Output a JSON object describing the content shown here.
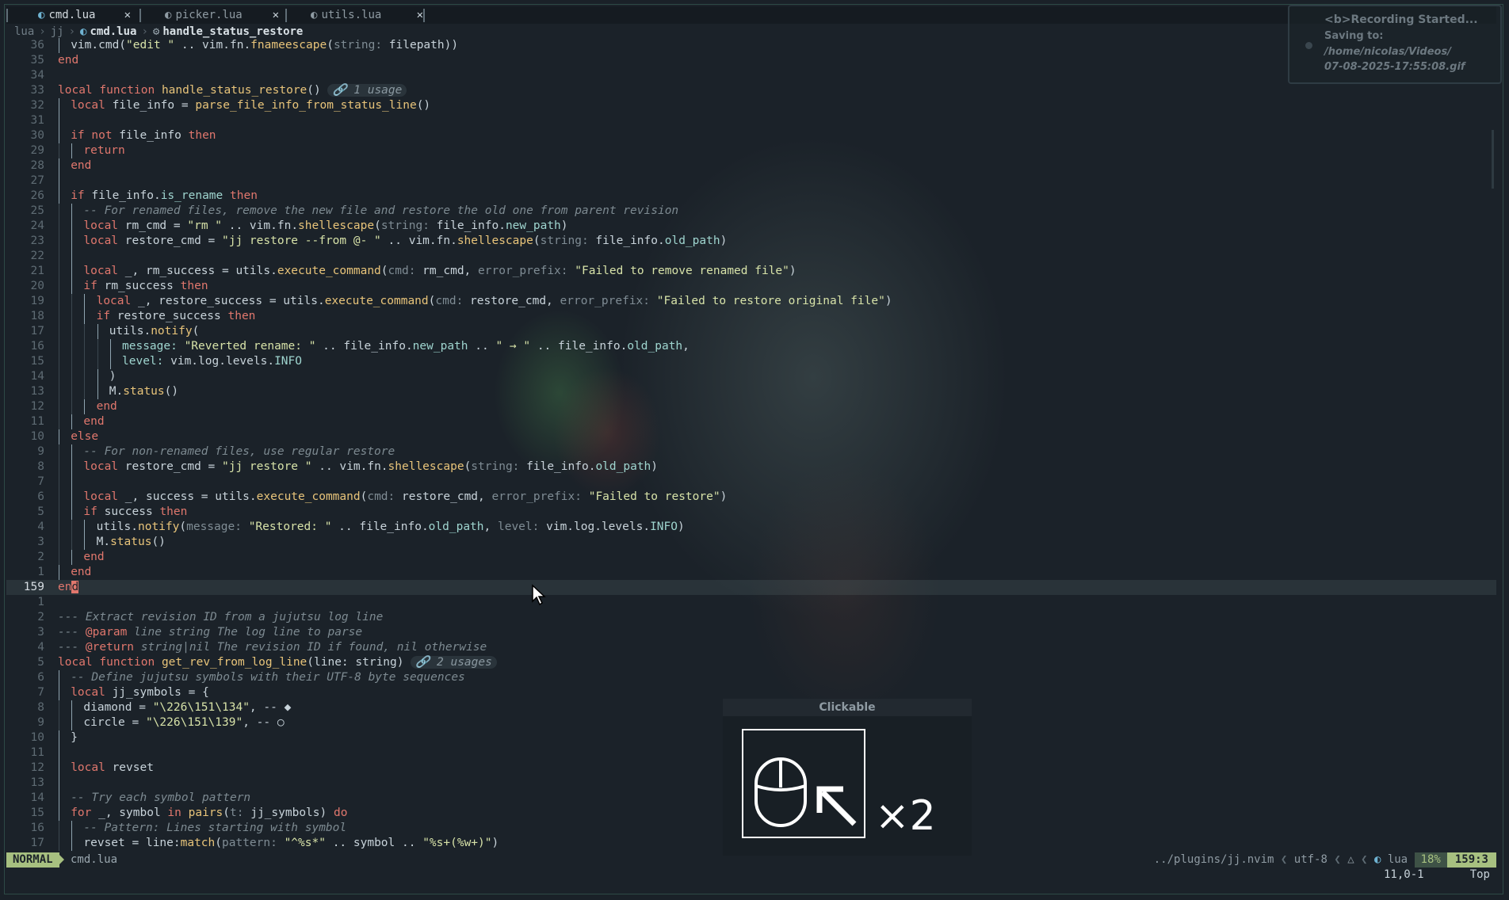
{
  "tabs": [
    {
      "label": "cmd.lua",
      "icon": "lua-file-icon",
      "active": true
    },
    {
      "label": "picker.lua",
      "icon": "lua-file-icon",
      "active": false
    },
    {
      "label": "utils.lua",
      "icon": "lua-file-icon",
      "active": false
    }
  ],
  "tab_close_glyph": "✕",
  "breadcrumb": {
    "part1": "lua",
    "part2": "jj",
    "file": "cmd.lua",
    "function": "handle_status_restore",
    "sep": "›"
  },
  "notification": {
    "title": "<b>Recording Started...",
    "line1": "Saving to:",
    "line2": "/home/nicolas/Videos/",
    "line3": "07-08-2025-17:55:08.gif"
  },
  "overlay": {
    "title": "Clickable",
    "count": "×2"
  },
  "statusline": {
    "mode": "NORMAL",
    "file": "cmd.lua",
    "path": "../plugins/jj.nvim",
    "encoding": "utf-8",
    "filetype": "lua",
    "percent": "18%",
    "position": "159:3"
  },
  "cmdline": {
    "ruler": "11,0-1",
    "scroll": "Top"
  },
  "colors": {
    "accent": "#a7c080",
    "keyword": "#e0776d",
    "string": "#d7e2a8",
    "function": "#e8c47a"
  },
  "lines": [
    {
      "n": "36",
      "d": 1,
      "c": [
        [
          "vim.cmd(",
          ""
        ],
        [
          "\"edit \"",
          "str"
        ],
        [
          " .. vim.fn.",
          ""
        ],
        [
          "fnameescape",
          "fnc"
        ],
        [
          "(",
          ""
        ],
        [
          "string:",
          "hint"
        ],
        [
          " filepath))",
          ""
        ]
      ]
    },
    {
      "n": "35",
      "d": 0,
      "c": [
        [
          "end",
          "kw"
        ]
      ]
    },
    {
      "n": "34",
      "d": 0,
      "c": []
    },
    {
      "n": "33",
      "d": 0,
      "c": [
        [
          "local function ",
          "kw"
        ],
        [
          "handle_status_restore",
          "fnc"
        ],
        [
          "() ",
          ""
        ]
      ],
      "usage": "🔗 1 usage"
    },
    {
      "n": "32",
      "d": 1,
      "c": [
        [
          "local ",
          "kw"
        ],
        [
          "file_info = ",
          ""
        ],
        [
          "parse_file_info_from_status_line",
          "fnc"
        ],
        [
          "()",
          ""
        ]
      ]
    },
    {
      "n": "31",
      "d": 1,
      "c": []
    },
    {
      "n": "30",
      "d": 1,
      "c": [
        [
          "if not ",
          "kw"
        ],
        [
          "file_info ",
          ""
        ],
        [
          "then",
          "kw"
        ]
      ]
    },
    {
      "n": "29",
      "d": 2,
      "c": [
        [
          "return",
          "kw"
        ]
      ]
    },
    {
      "n": "28",
      "d": 1,
      "c": [
        [
          "end",
          "kw"
        ]
      ]
    },
    {
      "n": "27",
      "d": 1,
      "c": []
    },
    {
      "n": "26",
      "d": 1,
      "c": [
        [
          "if ",
          "kw"
        ],
        [
          "file_info.",
          ""
        ],
        [
          "is_rename",
          "fld"
        ],
        [
          " ",
          ""
        ],
        [
          "then",
          "kw"
        ]
      ]
    },
    {
      "n": "25",
      "d": 2,
      "c": [
        [
          "-- For renamed files, remove the new file and restore the old one from parent revision",
          "cm"
        ]
      ]
    },
    {
      "n": "24",
      "d": 2,
      "c": [
        [
          "local ",
          "kw"
        ],
        [
          "rm_cmd = ",
          ""
        ],
        [
          "\"rm \"",
          "str"
        ],
        [
          " .. vim.fn.",
          ""
        ],
        [
          "shellescape",
          "fnc"
        ],
        [
          "(",
          ""
        ],
        [
          "string:",
          "hint"
        ],
        [
          " file_info.",
          ""
        ],
        [
          "new_path",
          "fld"
        ],
        [
          ")",
          ""
        ]
      ]
    },
    {
      "n": "23",
      "d": 2,
      "c": [
        [
          "local ",
          "kw"
        ],
        [
          "restore_cmd = ",
          ""
        ],
        [
          "\"jj restore --from @- \"",
          "str"
        ],
        [
          " .. vim.fn.",
          ""
        ],
        [
          "shellescape",
          "fnc"
        ],
        [
          "(",
          ""
        ],
        [
          "string:",
          "hint"
        ],
        [
          " file_info.",
          ""
        ],
        [
          "old_path",
          "fld"
        ],
        [
          ")",
          ""
        ]
      ]
    },
    {
      "n": "22",
      "d": 2,
      "c": []
    },
    {
      "n": "21",
      "d": 2,
      "c": [
        [
          "local ",
          "kw"
        ],
        [
          "_, rm_success = utils.",
          ""
        ],
        [
          "execute_command",
          "fnc"
        ],
        [
          "(",
          ""
        ],
        [
          "cmd:",
          "hint"
        ],
        [
          " rm_cmd, ",
          ""
        ],
        [
          "error_prefix:",
          "hint"
        ],
        [
          " ",
          ""
        ],
        [
          "\"Failed to remove renamed file\"",
          "str"
        ],
        [
          ")",
          ""
        ]
      ]
    },
    {
      "n": "20",
      "d": 2,
      "c": [
        [
          "if ",
          "kw"
        ],
        [
          "rm_success ",
          ""
        ],
        [
          "then",
          "kw"
        ]
      ]
    },
    {
      "n": "19",
      "d": 3,
      "c": [
        [
          "local ",
          "kw"
        ],
        [
          "_, restore_success = utils.",
          ""
        ],
        [
          "execute_command",
          "fnc"
        ],
        [
          "(",
          ""
        ],
        [
          "cmd:",
          "hint"
        ],
        [
          " restore_cmd, ",
          ""
        ],
        [
          "error_prefix:",
          "hint"
        ],
        [
          " ",
          ""
        ],
        [
          "\"Failed to restore original file\"",
          "str"
        ],
        [
          ")",
          ""
        ]
      ]
    },
    {
      "n": "18",
      "d": 3,
      "c": [
        [
          "if ",
          "kw"
        ],
        [
          "restore_success ",
          ""
        ],
        [
          "then",
          "kw"
        ]
      ]
    },
    {
      "n": "17",
      "d": 4,
      "c": [
        [
          "utils.",
          ""
        ],
        [
          "notify",
          "fnc"
        ],
        [
          "(",
          ""
        ]
      ]
    },
    {
      "n": "16",
      "d": 5,
      "c": [
        [
          "message:",
          "fld"
        ],
        [
          " ",
          ""
        ],
        [
          "\"Reverted rename: \"",
          "str"
        ],
        [
          " .. file_info.",
          ""
        ],
        [
          "new_path",
          "fld"
        ],
        [
          " .. ",
          ""
        ],
        [
          "\" → \"",
          "str"
        ],
        [
          " .. file_info.",
          ""
        ],
        [
          "old_path",
          "fld"
        ],
        [
          ",",
          ""
        ]
      ]
    },
    {
      "n": "15",
      "d": 5,
      "c": [
        [
          "level:",
          "fld"
        ],
        [
          " vim.log.levels.",
          ""
        ],
        [
          "INFO",
          "fld"
        ]
      ]
    },
    {
      "n": "14",
      "d": 4,
      "c": [
        [
          ")",
          ""
        ]
      ]
    },
    {
      "n": "13",
      "d": 4,
      "c": [
        [
          "M.",
          ""
        ],
        [
          "status",
          "fnc"
        ],
        [
          "()",
          ""
        ]
      ]
    },
    {
      "n": "12",
      "d": 3,
      "c": [
        [
          "end",
          "kw"
        ]
      ]
    },
    {
      "n": "11",
      "d": 2,
      "c": [
        [
          "end",
          "kw"
        ]
      ]
    },
    {
      "n": "10",
      "d": 1,
      "c": [
        [
          "else",
          "kw"
        ]
      ]
    },
    {
      "n": "9",
      "d": 2,
      "c": [
        [
          "-- For non-renamed files, use regular restore",
          "cm"
        ]
      ]
    },
    {
      "n": "8",
      "d": 2,
      "c": [
        [
          "local ",
          "kw"
        ],
        [
          "restore_cmd = ",
          ""
        ],
        [
          "\"jj restore \"",
          "str"
        ],
        [
          " .. vim.fn.",
          ""
        ],
        [
          "shellescape",
          "fnc"
        ],
        [
          "(",
          ""
        ],
        [
          "string:",
          "hint"
        ],
        [
          " file_info.",
          ""
        ],
        [
          "old_path",
          "fld"
        ],
        [
          ")",
          ""
        ]
      ]
    },
    {
      "n": "7",
      "d": 2,
      "c": []
    },
    {
      "n": "6",
      "d": 2,
      "c": [
        [
          "local ",
          "kw"
        ],
        [
          "_, success = utils.",
          ""
        ],
        [
          "execute_command",
          "fnc"
        ],
        [
          "(",
          ""
        ],
        [
          "cmd:",
          "hint"
        ],
        [
          " restore_cmd, ",
          ""
        ],
        [
          "error_prefix:",
          "hint"
        ],
        [
          " ",
          ""
        ],
        [
          "\"Failed to restore\"",
          "str"
        ],
        [
          ")",
          ""
        ]
      ]
    },
    {
      "n": "5",
      "d": 2,
      "c": [
        [
          "if ",
          "kw"
        ],
        [
          "success ",
          ""
        ],
        [
          "then",
          "kw"
        ]
      ]
    },
    {
      "n": "4",
      "d": 3,
      "c": [
        [
          "utils.",
          ""
        ],
        [
          "notify",
          "fnc"
        ],
        [
          "(",
          ""
        ],
        [
          "message:",
          "hint"
        ],
        [
          " ",
          ""
        ],
        [
          "\"Restored: \"",
          "str"
        ],
        [
          " .. file_info.",
          ""
        ],
        [
          "old_path",
          "fld"
        ],
        [
          ", ",
          ""
        ],
        [
          "level:",
          "hint"
        ],
        [
          " vim.log.levels.",
          ""
        ],
        [
          "INFO",
          "fld"
        ],
        [
          ")",
          ""
        ]
      ]
    },
    {
      "n": "3",
      "d": 3,
      "c": [
        [
          "M.",
          ""
        ],
        [
          "status",
          "fnc"
        ],
        [
          "()",
          ""
        ]
      ]
    },
    {
      "n": "2",
      "d": 2,
      "c": [
        [
          "end",
          "kw"
        ]
      ]
    },
    {
      "n": "1",
      "d": 1,
      "c": [
        [
          "end",
          "kw"
        ]
      ]
    },
    {
      "n": "159",
      "d": 0,
      "cur": true,
      "c": [
        [
          "en",
          "kw"
        ],
        [
          "d",
          "cursor"
        ]
      ]
    },
    {
      "n": "1",
      "d": 0,
      "c": []
    },
    {
      "n": "2",
      "d": 0,
      "c": [
        [
          "--- Extract revision ID from a jujutsu log line",
          "cm"
        ]
      ]
    },
    {
      "n": "3",
      "d": 0,
      "c": [
        [
          "--- ",
          "cm"
        ],
        [
          "@param",
          "kw"
        ],
        [
          " line string ",
          "cm"
        ],
        [
          "The log line to parse",
          "cm"
        ]
      ]
    },
    {
      "n": "4",
      "d": 0,
      "c": [
        [
          "--- ",
          "cm"
        ],
        [
          "@return",
          "kw"
        ],
        [
          " string|nil ",
          "cm"
        ],
        [
          "The revision ID if found, nil otherwise",
          "cm"
        ]
      ]
    },
    {
      "n": "5",
      "d": 0,
      "c": [
        [
          "local function ",
          "kw"
        ],
        [
          "get_rev_from_log_line",
          "fnc"
        ],
        [
          "(line: string) ",
          ""
        ]
      ],
      "usage": "🔗 2 usages"
    },
    {
      "n": "6",
      "d": 1,
      "c": [
        [
          "-- Define jujutsu symbols with their UTF-8 byte sequences",
          "cm"
        ]
      ]
    },
    {
      "n": "7",
      "d": 1,
      "c": [
        [
          "local ",
          "kw"
        ],
        [
          "jj_symbols = {",
          ""
        ]
      ]
    },
    {
      "n": "8",
      "d": 2,
      "c": [
        [
          "diamond = ",
          ""
        ],
        [
          "\"\\226\\151\\134\"",
          "str"
        ],
        [
          ", -- ◆",
          ""
        ]
      ]
    },
    {
      "n": "9",
      "d": 2,
      "c": [
        [
          "circle = ",
          ""
        ],
        [
          "\"\\226\\151\\139\"",
          "str"
        ],
        [
          ", -- ○",
          ""
        ]
      ]
    },
    {
      "n": "10",
      "d": 1,
      "c": [
        [
          "}",
          ""
        ]
      ]
    },
    {
      "n": "11",
      "d": 1,
      "c": []
    },
    {
      "n": "12",
      "d": 1,
      "c": [
        [
          "local ",
          "kw"
        ],
        [
          "revset",
          ""
        ]
      ]
    },
    {
      "n": "13",
      "d": 1,
      "c": []
    },
    {
      "n": "14",
      "d": 1,
      "c": [
        [
          "-- Try each symbol pattern",
          "cm"
        ]
      ]
    },
    {
      "n": "15",
      "d": 1,
      "c": [
        [
          "for ",
          "kw"
        ],
        [
          "_, symbol ",
          ""
        ],
        [
          "in ",
          "kw"
        ],
        [
          "pairs",
          "fnc"
        ],
        [
          "(",
          ""
        ],
        [
          "t:",
          "hint"
        ],
        [
          " jj_symbols) ",
          ""
        ],
        [
          "do",
          "kw"
        ]
      ]
    },
    {
      "n": "16",
      "d": 2,
      "c": [
        [
          "-- Pattern: Lines starting with symbol",
          "cm"
        ]
      ]
    },
    {
      "n": "17",
      "d": 2,
      "c": [
        [
          "revset = line:",
          ""
        ],
        [
          "match",
          "fnc"
        ],
        [
          "(",
          ""
        ],
        [
          "pattern:",
          "hint"
        ],
        [
          " ",
          ""
        ],
        [
          "\"^%s*\"",
          "str"
        ],
        [
          " .. symbol .. ",
          ""
        ],
        [
          "\"%s+(%w+)\"",
          "str"
        ],
        [
          ")",
          ""
        ]
      ]
    }
  ]
}
